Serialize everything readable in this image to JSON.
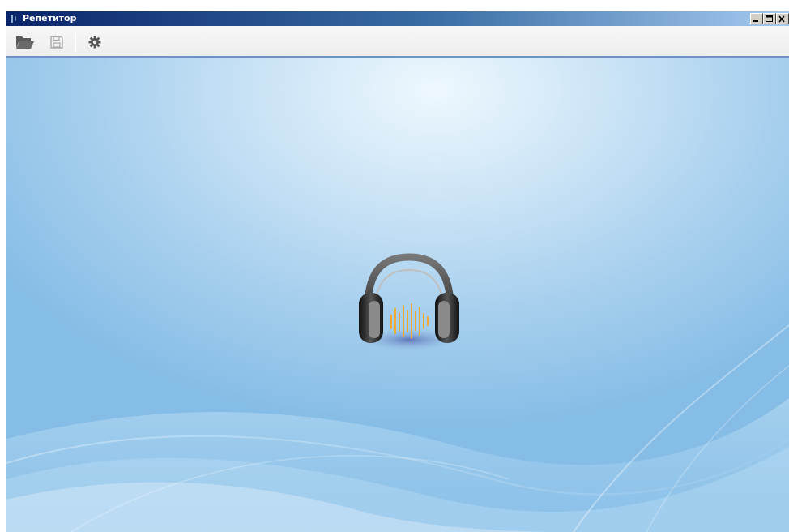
{
  "window": {
    "title": "Репетитор",
    "controls": [
      "minimize-icon",
      "maximize-icon",
      "close-icon"
    ]
  },
  "toolbar": {
    "buttons": [
      {
        "name": "open",
        "icon": "folder-open-icon"
      },
      {
        "name": "save",
        "icon": "save-icon",
        "enabled": false
      },
      {
        "name": "settings",
        "icon": "gear-icon"
      }
    ]
  },
  "content": {
    "logo": "headphones-icon"
  },
  "colors": {
    "titlebar_start": "#0a246a",
    "titlebar_end": "#a6caf0",
    "toolbar_border": "#6f93c0",
    "background_light": "#eef8fe",
    "background_dark": "#86bde6",
    "waveform": "#f0a830"
  }
}
